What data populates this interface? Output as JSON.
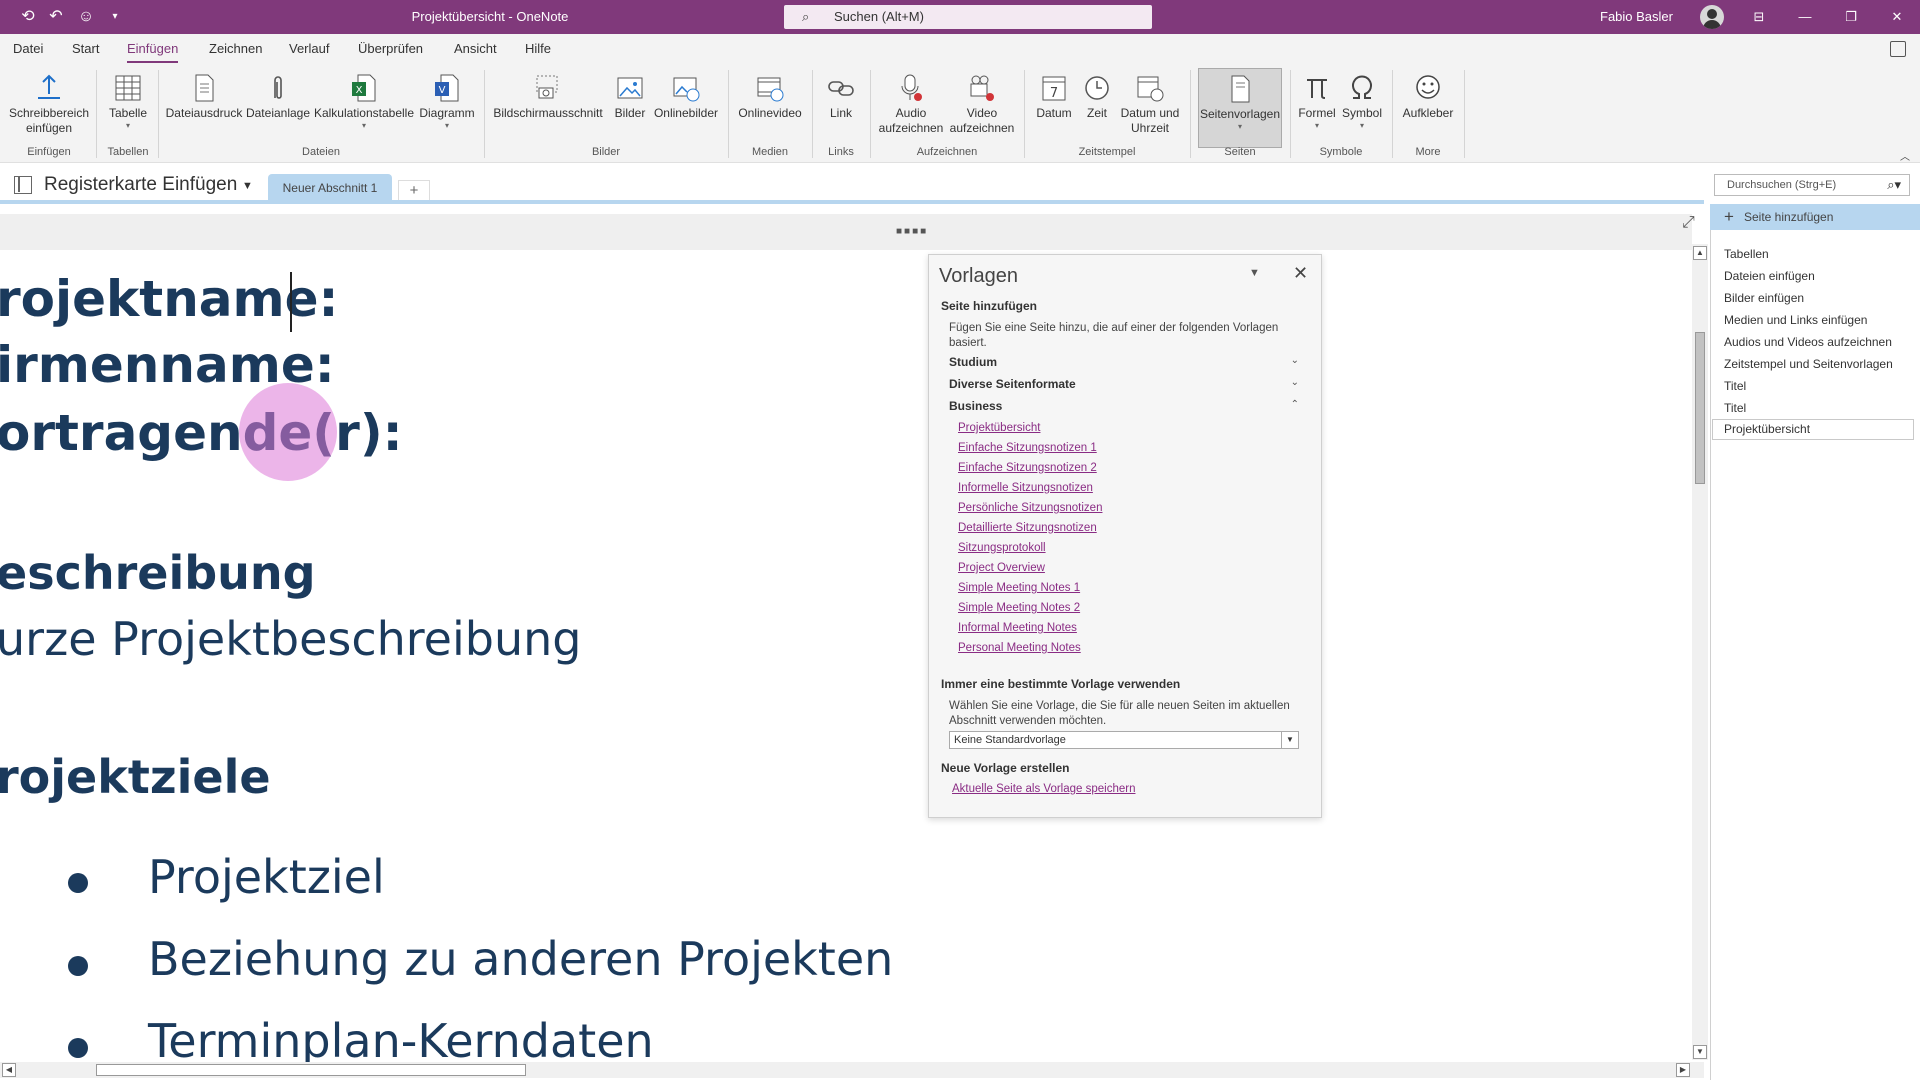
{
  "titlebar": {
    "title": "Projektübersicht  -  OneNote",
    "search_placeholder": "Suchen (Alt+M)",
    "user_name": "Fabio Basler"
  },
  "menu": [
    "Datei",
    "Start",
    "Einfügen",
    "Zeichnen",
    "Verlauf",
    "Überprüfen",
    "Ansicht",
    "Hilfe"
  ],
  "menu_active": "Einfügen",
  "ribbon": {
    "buttons": [
      {
        "label1": "Schreibbereich",
        "label2": "einfügen"
      },
      {
        "label1": "Tabelle",
        "label2": ""
      },
      {
        "label1": "Dateiausdruck",
        "label2": ""
      },
      {
        "label1": "Dateianlage",
        "label2": ""
      },
      {
        "label1": "Kalkulationstabelle",
        "label2": ""
      },
      {
        "label1": "Diagramm",
        "label2": ""
      },
      {
        "label1": "Bildschirmausschnitt",
        "label2": ""
      },
      {
        "label1": "Bilder",
        "label2": ""
      },
      {
        "label1": "Onlinebilder",
        "label2": ""
      },
      {
        "label1": "Onlinevideo",
        "label2": ""
      },
      {
        "label1": "Link",
        "label2": ""
      },
      {
        "label1": "Audio",
        "label2": "aufzeichnen"
      },
      {
        "label1": "Video",
        "label2": "aufzeichnen"
      },
      {
        "label1": "Datum",
        "label2": ""
      },
      {
        "label1": "Zeit",
        "label2": ""
      },
      {
        "label1": "Datum und",
        "label2": "Uhrzeit"
      },
      {
        "label1": "Seitenvorlagen",
        "label2": ""
      },
      {
        "label1": "Formel",
        "label2": ""
      },
      {
        "label1": "Symbol",
        "label2": ""
      },
      {
        "label1": "Aufkleber",
        "label2": ""
      }
    ],
    "groups": [
      "Einfügen",
      "Tabellen",
      "Dateien",
      "Bilder",
      "Medien",
      "Links",
      "Aufzeichnen",
      "Zeitstempel",
      "Seiten",
      "Symbole",
      "More"
    ]
  },
  "notebook": {
    "name": "Registerkarte Einfügen",
    "section": "Neuer Abschnitt 1",
    "add_tab": "+",
    "search_placeholder": "Durchsuchen (Strg+E)"
  },
  "page": {
    "lines": [
      "rojektname:",
      "irmenname:",
      "ortragende(r):",
      "eschreibung",
      "urze Projektbeschreibung",
      "rojektziele"
    ],
    "bullets": [
      "Projektziel",
      "Beziehung zu anderen Projekten",
      "Terminplan-Kerndaten"
    ]
  },
  "pages_panel": {
    "add_page": "Seite hinzufügen",
    "items": [
      "Tabellen",
      "Dateien einfügen",
      "Bilder einfügen",
      "Medien und Links einfügen",
      "Audios und Videos aufzeichnen",
      "Zeitstempel und Seitenvorlagen",
      "Titel",
      "Titel",
      "Projektübersicht"
    ]
  },
  "templates": {
    "title": "Vorlagen",
    "add_heading": "Seite hinzufügen",
    "add_desc": "Fügen Sie eine Seite hinzu, die auf einer der folgenden Vorlagen basiert.",
    "categories": [
      "Studium",
      "Diverse Seitenformate",
      "Business"
    ],
    "business_links": [
      "Projektübersicht",
      "Einfache Sitzungsnotizen 1",
      "Einfache Sitzungsnotizen 2",
      "Informelle Sitzungsnotizen",
      "Persönliche Sitzungsnotizen",
      "Detaillierte Sitzungsnotizen",
      "Sitzungsprotokoll",
      "Project Overview",
      "Simple Meeting Notes 1",
      "Simple Meeting Notes 2",
      "Informal Meeting Notes",
      "Personal Meeting Notes"
    ],
    "default_heading": "Immer eine bestimmte Vorlage verwenden",
    "default_desc": "Wählen Sie eine Vorlage, die Sie für alle neuen Seiten im aktuellen Abschnitt verwenden möchten.",
    "default_value": "Keine Standardvorlage",
    "new_heading": "Neue Vorlage erstellen",
    "save_link": "Aktuelle Seite als Vorlage speichern"
  },
  "colors": {
    "titlebar": "#80397b",
    "accent": "#80397b",
    "section_tab": "#b7d6ef",
    "page_text": "#1b3a5c",
    "link": "#8a2c84"
  }
}
